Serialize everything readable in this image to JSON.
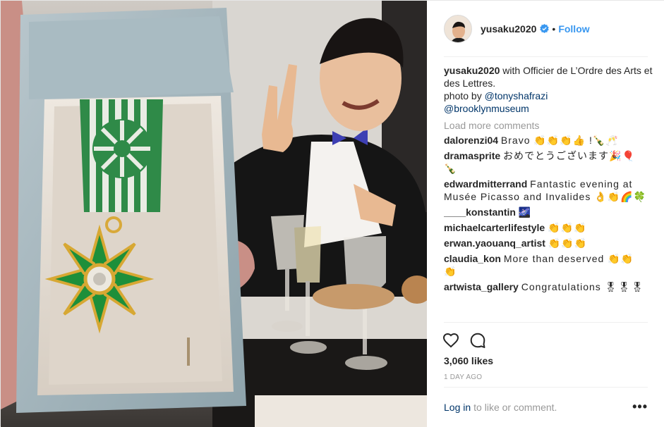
{
  "author": {
    "username": "yusaku2020",
    "follow_label": "Follow",
    "separator": "•",
    "verified_icon": "verified-badge-icon"
  },
  "caption": {
    "username": "yusaku2020",
    "text": "with Officier de L’Ordre des Arts et des Lettres.",
    "line2_prefix": "photo by",
    "mention1": "@tonyshafrazi",
    "mention2": "@brooklynmuseum"
  },
  "load_more": "Load more comments",
  "comments": [
    {
      "username": "dalorenzi04",
      "text": "Bravo 👏👏👏👍 !🍾🥂"
    },
    {
      "username": "dramasprite",
      "text": "おめでとうございます🎉🎈🍾"
    },
    {
      "username": "edwardmitterrand",
      "text": "Fantastic evening at Musée Picasso and Invalides 👌👏🌈🍀"
    },
    {
      "username": "____konstantin",
      "text": "🌌"
    },
    {
      "username": "michaelcarterlifestyle",
      "text": "👏👏👏"
    },
    {
      "username": "erwan.yaouanq_artist",
      "text": "👏👏👏"
    },
    {
      "username": "claudia_kon",
      "text": "More than deserved 👏👏👏"
    },
    {
      "username": "artwista_gallery",
      "text": "Congratulations 🎖🎖🎖"
    }
  ],
  "likes": "3,060 likes",
  "time": "1 DAY AGO",
  "add_comment": {
    "login": "Log in",
    "rest": "to like or comment.",
    "more": "•••"
  },
  "colors": {
    "link": "#3897f0",
    "mention": "#003569",
    "muted": "#999999"
  }
}
